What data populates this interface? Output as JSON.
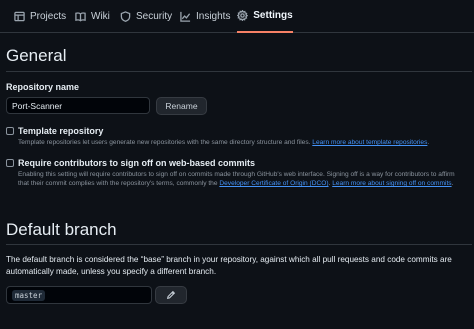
{
  "tabs": [
    {
      "label": "Projects",
      "icon": "table-icon"
    },
    {
      "label": "Wiki",
      "icon": "book-icon"
    },
    {
      "label": "Security",
      "icon": "shield-icon"
    },
    {
      "label": "Insights",
      "icon": "graph-icon"
    },
    {
      "label": "Settings",
      "icon": "gear-icon",
      "active": true
    }
  ],
  "general": {
    "heading": "General",
    "repo_name_label": "Repository name",
    "repo_name_value": "Port-Scanner",
    "rename_label": "Rename",
    "template": {
      "title": "Template repository",
      "description": "Template repositories let users generate new repositories with the same directory structure and files. ",
      "link": "Learn more about template repositories",
      "link_suffix": "."
    },
    "signoff": {
      "title": "Require contributors to sign off on web-based commits",
      "description_1": "Enabling this setting will require contributors to sign off on commits made through GitHub's web interface. Signing off is a way for contributors to affirm that their commit complies with the repository's terms, commonly the ",
      "link_1": "Developer Certificate of Origin (DCO)",
      "description_2": ". ",
      "link_2": "Learn more about signing off on commits",
      "link_suffix": "."
    }
  },
  "default_branch": {
    "heading": "Default branch",
    "description": "The default branch is considered the “base” branch in your repository, against which all pull requests and code commits are automatically made, unless you specify a different branch.",
    "branch": "master",
    "edit_icon": "pencil-icon"
  },
  "colors": {
    "background": "#0d1117",
    "accent_underline": "#f78166",
    "link": "#4493f8"
  }
}
